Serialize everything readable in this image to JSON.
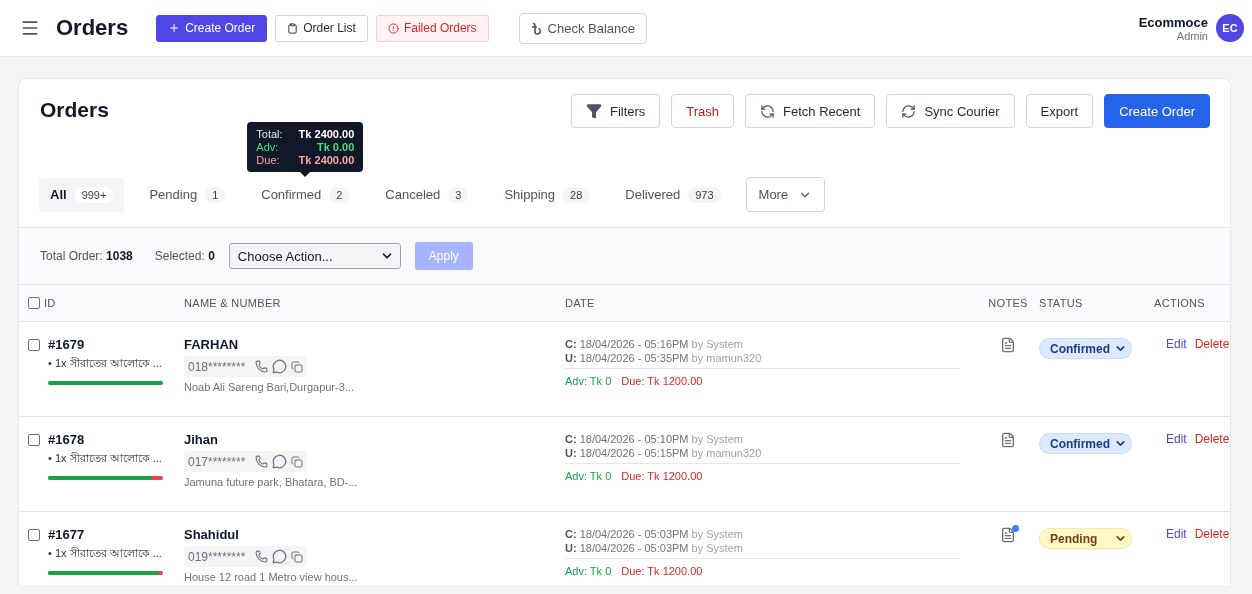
{
  "topbar": {
    "title": "Orders",
    "buttons": [
      {
        "label": "Create Order",
        "kind": "primary"
      },
      {
        "label": "Order List",
        "kind": "plain"
      },
      {
        "label": "Failed Orders",
        "kind": "danger"
      }
    ],
    "balance_button": "Check Balance",
    "user": {
      "name": "Ecommoce",
      "role": "Admin",
      "initials": "EC"
    }
  },
  "card": {
    "title": "Orders",
    "actions": [
      {
        "label": "Filters",
        "kind": "filter"
      },
      {
        "label": "Trash",
        "kind": "trash"
      },
      {
        "label": "Fetch Recent",
        "kind": "fetch"
      },
      {
        "label": "Sync Courier",
        "kind": "sync"
      },
      {
        "label": "Export",
        "kind": "plain"
      },
      {
        "label": "Create Order",
        "kind": "primary"
      }
    ],
    "tabs": [
      {
        "label": "All",
        "count": "999+",
        "selected": true
      },
      {
        "label": "Pending",
        "count": "1",
        "selected": false
      },
      {
        "label": "Confirmed",
        "count": "2",
        "selected": false,
        "tooltip": {
          "rows": [
            {
              "label": "Total:",
              "value": "Tk 2400.00",
              "kind": "total"
            },
            {
              "label": "Adv:",
              "value": "Tk 0.00",
              "kind": "adv"
            },
            {
              "label": "Due:",
              "value": "Tk 2400.00",
              "kind": "due"
            }
          ]
        }
      },
      {
        "label": "Canceled",
        "count": "3",
        "selected": false
      },
      {
        "label": "Shipping",
        "count": "28",
        "selected": false
      },
      {
        "label": "Delivered",
        "count": "973",
        "selected": false
      }
    ],
    "more_label": "More",
    "toolbar": {
      "total_label": "Total Order:",
      "total": "1038",
      "selected_label": "Selected:",
      "selected": "0",
      "action_value": "Choose Action...",
      "apply": "Apply"
    },
    "table": {
      "columns": [
        "ID",
        "NAME & NUMBER",
        "DATE",
        "NOTES",
        "STATUS",
        "ACTIONS"
      ],
      "select_all_checked": false,
      "rows": [
        {
          "checked": false,
          "id": "#1679",
          "item": "• 1x সীরাতের আলোকে ...",
          "level": 1,
          "name": "FARHAN",
          "phone": "018********",
          "address": "Noab Ali Sareng Bari,Durgapur-3...",
          "created_prefix": "C:",
          "created": "18/04/2026 - 05:16PM",
          "created_by": "by System",
          "updated_prefix": "U:",
          "updated": "18/04/2026 - 05:35PM",
          "updated_by": "by mamun320",
          "adv": "Adv: Tk 0",
          "due": "Due: Tk 1200.00",
          "has_note": false,
          "status": "Confirmed",
          "color": "#dbeafe",
          "edit": "Edit",
          "delete": "Delete"
        },
        {
          "checked": false,
          "id": "#1678",
          "item": "• 1x সীরাতের আলোকে ...",
          "level": 0.9,
          "name": "Jihan",
          "phone": "017********",
          "address": "Jamuna future park, Bhatara, BD-...",
          "created_prefix": "C:",
          "created": "18/04/2026 - 05:10PM",
          "created_by": "by System",
          "updated_prefix": "U:",
          "updated": "18/04/2026 - 05:15PM",
          "updated_by": "by mamun320",
          "adv": "Adv: Tk 0",
          "due": "Due: Tk 1200.00",
          "has_note": false,
          "status": "Confirmed",
          "color": "#dbeafe",
          "edit": "Edit",
          "delete": "Delete"
        },
        {
          "checked": false,
          "id": "#1677",
          "item": "• 1x সীরাতের আলোকে ...",
          "level": 0.96,
          "name": "Shahidul",
          "phone": "019********",
          "address": "House 12 road 1 Metro view hous...",
          "created_prefix": "C:",
          "created": "18/04/2026 - 05:03PM",
          "created_by": "by System",
          "updated_prefix": "U:",
          "updated": "18/04/2026 - 05:03PM",
          "updated_by": "by System",
          "adv": "Adv: Tk 0",
          "due": "Due: Tk 1200.00",
          "has_note": true,
          "status": "Pending",
          "color": "#fef9c3",
          "edit": "Edit",
          "delete": "Delete"
        }
      ]
    }
  }
}
